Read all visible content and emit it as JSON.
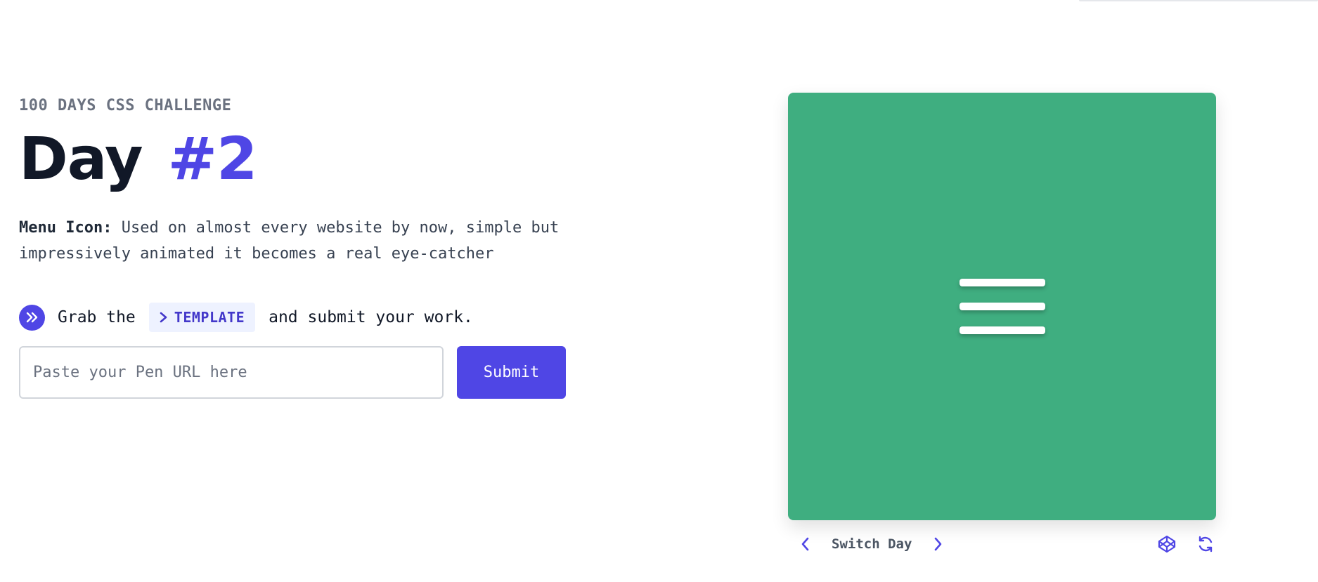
{
  "header": {
    "eyebrow": "100 DAYS CSS CHALLENGE",
    "title_day": "Day",
    "title_number": "#2"
  },
  "description": {
    "label": "Menu Icon:",
    "text": "Used on almost every website by now, simple but impressively animated it becomes a real eye-catcher"
  },
  "grab": {
    "icon": "double-chevron-right-icon",
    "prefix": "Grab the",
    "template_label": "TEMPLATE",
    "suffix": "and submit your work."
  },
  "form": {
    "placeholder": "Paste your Pen URL here",
    "submit_label": "Submit"
  },
  "preview": {
    "background": "#3fae80",
    "icon": "hamburger-menu-icon"
  },
  "controls": {
    "switch_label": "Switch Day",
    "prev_icon": "chevron-left-icon",
    "next_icon": "chevron-right-icon",
    "codepen_icon": "codepen-icon",
    "reload_icon": "refresh-icon"
  },
  "colors": {
    "accent": "#4f46e5",
    "chip_bg": "#eef2ff"
  }
}
